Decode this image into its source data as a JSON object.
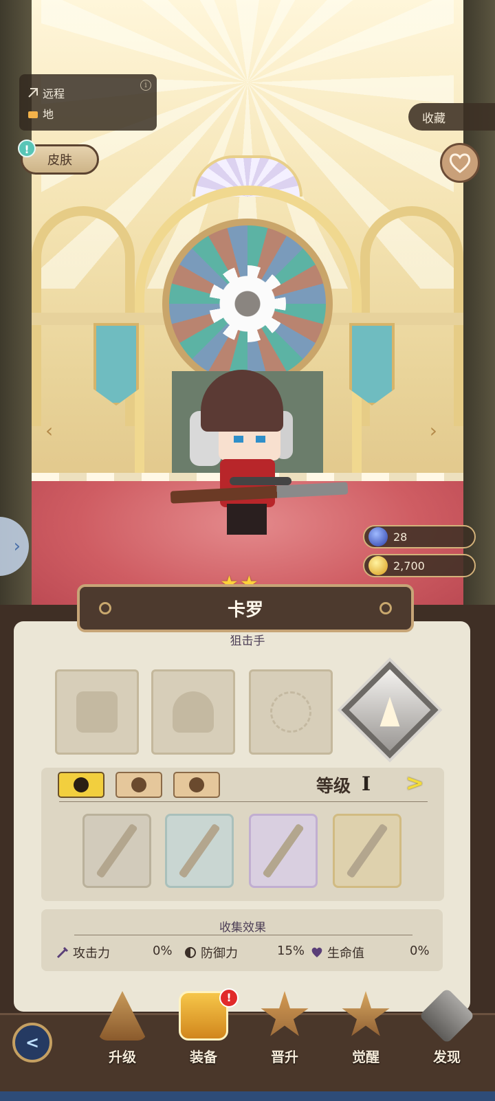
{
  "character": {
    "stars": 2,
    "name": "卡罗",
    "class": "狙击手"
  },
  "info": {
    "attack_type": "远程",
    "terrain": "地",
    "info_glyph": "i"
  },
  "buttons": {
    "skin": "皮肤",
    "skin_alert": "!",
    "collect": "收藏",
    "back_glyph": "<"
  },
  "resources": {
    "gems": "28",
    "gold": "2,700"
  },
  "equipment": {
    "slots": [
      "weapon-slot",
      "armor-slot",
      "accessory-slot"
    ],
    "categories": [
      "weapon",
      "armor",
      "accessory"
    ],
    "active_category": "weapon",
    "level_label": "等级",
    "level_value": "I",
    "next_glyph": ">",
    "rarities": [
      "common",
      "uncommon",
      "rare",
      "epic"
    ]
  },
  "collection_effect": {
    "title": "收集效果",
    "stats": [
      {
        "label": "攻击力",
        "value": "0%",
        "icon": "sword-icon"
      },
      {
        "label": "防御力",
        "value": "15%",
        "icon": "shield-icon"
      },
      {
        "label": "生命值",
        "value": "0%",
        "icon": "heart-icon"
      }
    ]
  },
  "nav": {
    "items": [
      "升级",
      "装备",
      "晋升",
      "觉醒",
      "发现"
    ],
    "active": "装备",
    "equip_alert": "!"
  },
  "colors": {
    "accent_gold": "#f2cf3e",
    "alert_red": "#e12a2a",
    "alert_teal": "#58c5b6"
  }
}
